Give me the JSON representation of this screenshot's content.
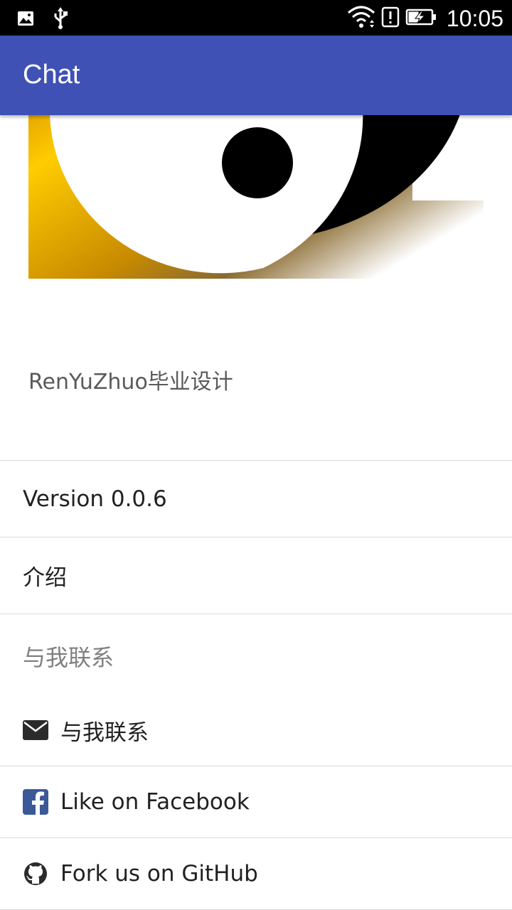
{
  "status_bar": {
    "time": "10:05",
    "icons": [
      "image-icon",
      "usb-icon",
      "wifi-icon",
      "alert-icon",
      "battery-charging-icon"
    ]
  },
  "app_bar": {
    "title": "Chat"
  },
  "header": {
    "subtitle": "RenYuZhuo毕业设计"
  },
  "list": {
    "version": "Version 0.0.6",
    "intro": "介绍",
    "section_contact": "与我联系",
    "contact_email": "与我联系",
    "facebook": "Like on Facebook",
    "github": "Fork us on GitHub"
  },
  "colors": {
    "primary": "#3f51b5",
    "status_bar": "#000000",
    "facebook": "#3b5998",
    "icon_dark": "#2b2b2b"
  }
}
